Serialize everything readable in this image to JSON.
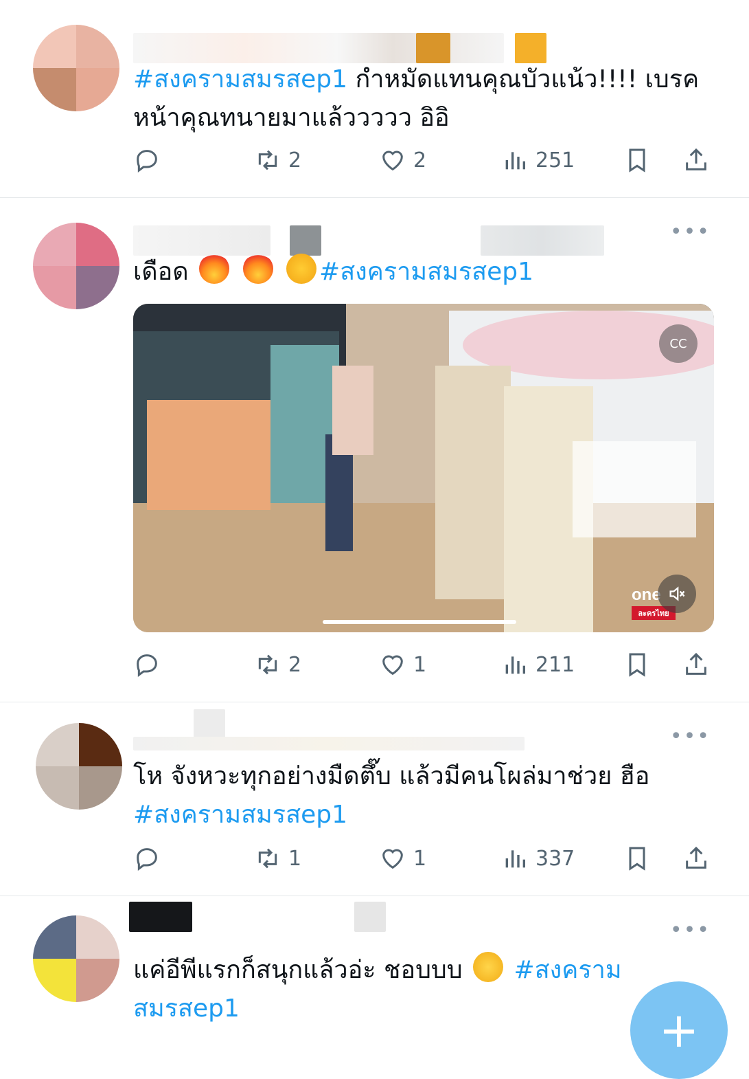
{
  "tweets": [
    {
      "text": "กำหมัดแทนคุณบัวแน้ว!!!! เบรคหน้าคุณทนายมาแล้ววววว อิอิ",
      "hashtag": "#สงครามสมรสep1",
      "reply_count": "",
      "retweet_count": "2",
      "like_count": "2",
      "view_count": "251"
    },
    {
      "text_before": "เดือด",
      "emojis": [
        "fire",
        "fire",
        "rolling-laughing"
      ],
      "hashtag": "#สงครามสมรสep1",
      "media": {
        "type": "video",
        "overlay_badge": "one",
        "overlay_badge_sub": "ละครไทย",
        "muted": true
      },
      "retweet_count": "2",
      "like_count": "1",
      "view_count": "211"
    },
    {
      "text": "โห จังหวะทุกอย่างมืดตึ๊บ แล้วมีคนโผล่มาช่วย ฮือ",
      "hashtag": "#สงครามสมรสep1",
      "retweet_count": "1",
      "like_count": "1",
      "view_count": "337"
    },
    {
      "text": "แค่อีพีแรกก็สนุกแล้วอ่ะ ชอบบบ",
      "emoji": "face-peeking",
      "hashtag_part1": "#สงคราม",
      "hashtag_part2": "สมรสep1"
    }
  ],
  "colors": {
    "accent": "#1d9bf0",
    "muted": "#536471",
    "divider": "#e6e9eb",
    "fab": "#7cc4f3"
  },
  "icons": [
    "reply-icon",
    "retweet-icon",
    "like-icon",
    "views-icon",
    "bookmark-icon",
    "share-icon",
    "more-icon",
    "mute-icon",
    "captions-icon",
    "compose-icon"
  ],
  "fab_label": "+"
}
